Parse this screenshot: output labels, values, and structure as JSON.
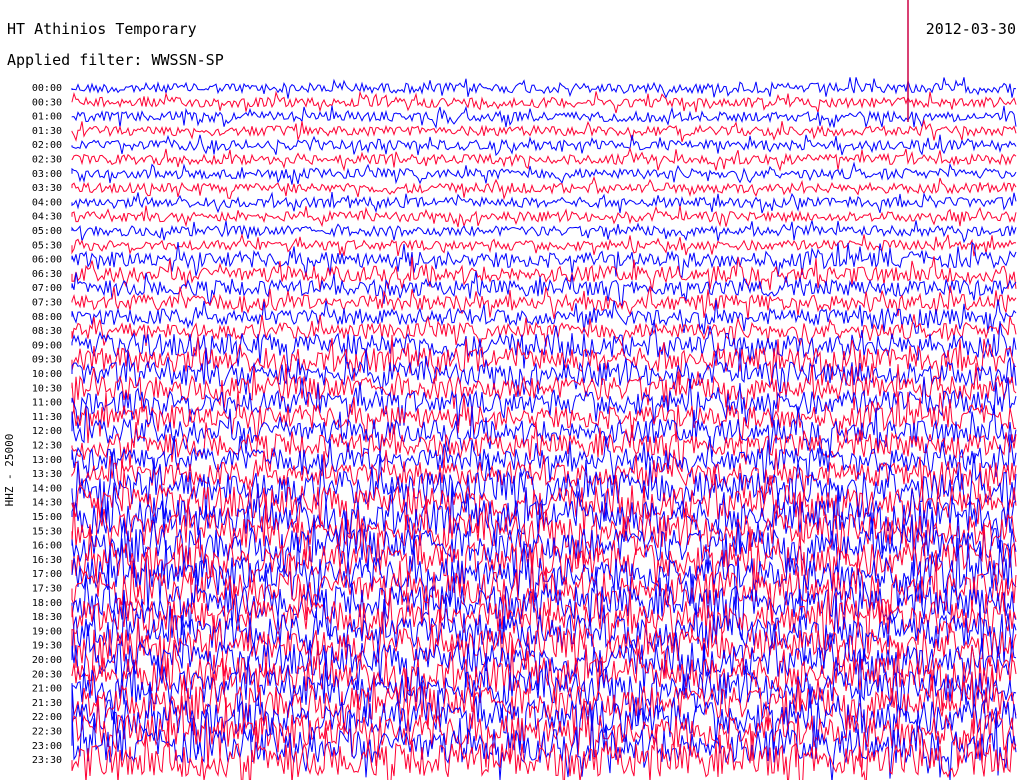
{
  "chart_data": {
    "type": "line",
    "title": "HT Athinios Temporary",
    "subtitle": "Applied filter: WWSSN-SP",
    "date": "2012-03-30",
    "ylabel": "HHZ - 25000",
    "tick_labels": [
      "00:00",
      "00:30",
      "01:00",
      "01:30",
      "02:00",
      "02:30",
      "03:00",
      "03:30",
      "04:00",
      "04:30",
      "05:00",
      "05:30",
      "06:00",
      "06:30",
      "07:00",
      "07:30",
      "08:00",
      "08:30",
      "09:00",
      "09:30",
      "10:00",
      "10:30",
      "11:00",
      "11:30",
      "12:00",
      "12:30",
      "13:00",
      "13:30",
      "14:00",
      "14:30",
      "15:00",
      "15:30",
      "16:00",
      "16:30",
      "17:00",
      "17:30",
      "18:00",
      "18:30",
      "19:00",
      "19:30",
      "20:00",
      "20:30",
      "21:00",
      "21:30",
      "22:00",
      "22:30",
      "23:00",
      "23:30"
    ],
    "series_colors": [
      "#0000ff",
      "#ff0033"
    ],
    "colors": {
      "background": "#ffffff",
      "text": "#000000",
      "marker": "#cc0044"
    }
  }
}
